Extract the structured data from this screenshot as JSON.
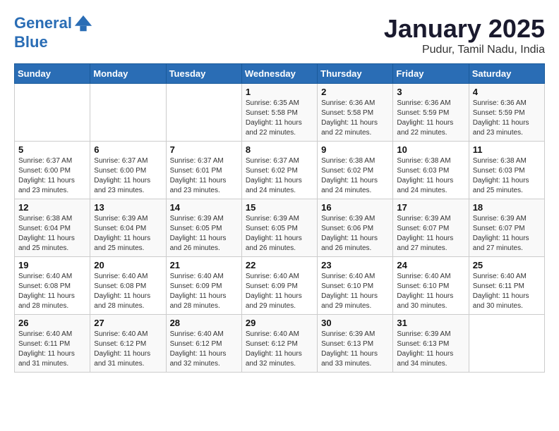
{
  "header": {
    "logo_line1": "General",
    "logo_line2": "Blue",
    "month": "January 2025",
    "location": "Pudur, Tamil Nadu, India"
  },
  "weekdays": [
    "Sunday",
    "Monday",
    "Tuesday",
    "Wednesday",
    "Thursday",
    "Friday",
    "Saturday"
  ],
  "weeks": [
    [
      {
        "day": "",
        "info": ""
      },
      {
        "day": "",
        "info": ""
      },
      {
        "day": "",
        "info": ""
      },
      {
        "day": "1",
        "info": "Sunrise: 6:35 AM\nSunset: 5:58 PM\nDaylight: 11 hours\nand 22 minutes."
      },
      {
        "day": "2",
        "info": "Sunrise: 6:36 AM\nSunset: 5:58 PM\nDaylight: 11 hours\nand 22 minutes."
      },
      {
        "day": "3",
        "info": "Sunrise: 6:36 AM\nSunset: 5:59 PM\nDaylight: 11 hours\nand 22 minutes."
      },
      {
        "day": "4",
        "info": "Sunrise: 6:36 AM\nSunset: 5:59 PM\nDaylight: 11 hours\nand 23 minutes."
      }
    ],
    [
      {
        "day": "5",
        "info": "Sunrise: 6:37 AM\nSunset: 6:00 PM\nDaylight: 11 hours\nand 23 minutes."
      },
      {
        "day": "6",
        "info": "Sunrise: 6:37 AM\nSunset: 6:00 PM\nDaylight: 11 hours\nand 23 minutes."
      },
      {
        "day": "7",
        "info": "Sunrise: 6:37 AM\nSunset: 6:01 PM\nDaylight: 11 hours\nand 23 minutes."
      },
      {
        "day": "8",
        "info": "Sunrise: 6:37 AM\nSunset: 6:02 PM\nDaylight: 11 hours\nand 24 minutes."
      },
      {
        "day": "9",
        "info": "Sunrise: 6:38 AM\nSunset: 6:02 PM\nDaylight: 11 hours\nand 24 minutes."
      },
      {
        "day": "10",
        "info": "Sunrise: 6:38 AM\nSunset: 6:03 PM\nDaylight: 11 hours\nand 24 minutes."
      },
      {
        "day": "11",
        "info": "Sunrise: 6:38 AM\nSunset: 6:03 PM\nDaylight: 11 hours\nand 25 minutes."
      }
    ],
    [
      {
        "day": "12",
        "info": "Sunrise: 6:38 AM\nSunset: 6:04 PM\nDaylight: 11 hours\nand 25 minutes."
      },
      {
        "day": "13",
        "info": "Sunrise: 6:39 AM\nSunset: 6:04 PM\nDaylight: 11 hours\nand 25 minutes."
      },
      {
        "day": "14",
        "info": "Sunrise: 6:39 AM\nSunset: 6:05 PM\nDaylight: 11 hours\nand 26 minutes."
      },
      {
        "day": "15",
        "info": "Sunrise: 6:39 AM\nSunset: 6:05 PM\nDaylight: 11 hours\nand 26 minutes."
      },
      {
        "day": "16",
        "info": "Sunrise: 6:39 AM\nSunset: 6:06 PM\nDaylight: 11 hours\nand 26 minutes."
      },
      {
        "day": "17",
        "info": "Sunrise: 6:39 AM\nSunset: 6:07 PM\nDaylight: 11 hours\nand 27 minutes."
      },
      {
        "day": "18",
        "info": "Sunrise: 6:39 AM\nSunset: 6:07 PM\nDaylight: 11 hours\nand 27 minutes."
      }
    ],
    [
      {
        "day": "19",
        "info": "Sunrise: 6:40 AM\nSunset: 6:08 PM\nDaylight: 11 hours\nand 28 minutes."
      },
      {
        "day": "20",
        "info": "Sunrise: 6:40 AM\nSunset: 6:08 PM\nDaylight: 11 hours\nand 28 minutes."
      },
      {
        "day": "21",
        "info": "Sunrise: 6:40 AM\nSunset: 6:09 PM\nDaylight: 11 hours\nand 28 minutes."
      },
      {
        "day": "22",
        "info": "Sunrise: 6:40 AM\nSunset: 6:09 PM\nDaylight: 11 hours\nand 29 minutes."
      },
      {
        "day": "23",
        "info": "Sunrise: 6:40 AM\nSunset: 6:10 PM\nDaylight: 11 hours\nand 29 minutes."
      },
      {
        "day": "24",
        "info": "Sunrise: 6:40 AM\nSunset: 6:10 PM\nDaylight: 11 hours\nand 30 minutes."
      },
      {
        "day": "25",
        "info": "Sunrise: 6:40 AM\nSunset: 6:11 PM\nDaylight: 11 hours\nand 30 minutes."
      }
    ],
    [
      {
        "day": "26",
        "info": "Sunrise: 6:40 AM\nSunset: 6:11 PM\nDaylight: 11 hours\nand 31 minutes."
      },
      {
        "day": "27",
        "info": "Sunrise: 6:40 AM\nSunset: 6:12 PM\nDaylight: 11 hours\nand 31 minutes."
      },
      {
        "day": "28",
        "info": "Sunrise: 6:40 AM\nSunset: 6:12 PM\nDaylight: 11 hours\nand 32 minutes."
      },
      {
        "day": "29",
        "info": "Sunrise: 6:40 AM\nSunset: 6:12 PM\nDaylight: 11 hours\nand 32 minutes."
      },
      {
        "day": "30",
        "info": "Sunrise: 6:39 AM\nSunset: 6:13 PM\nDaylight: 11 hours\nand 33 minutes."
      },
      {
        "day": "31",
        "info": "Sunrise: 6:39 AM\nSunset: 6:13 PM\nDaylight: 11 hours\nand 34 minutes."
      },
      {
        "day": "",
        "info": ""
      }
    ]
  ]
}
